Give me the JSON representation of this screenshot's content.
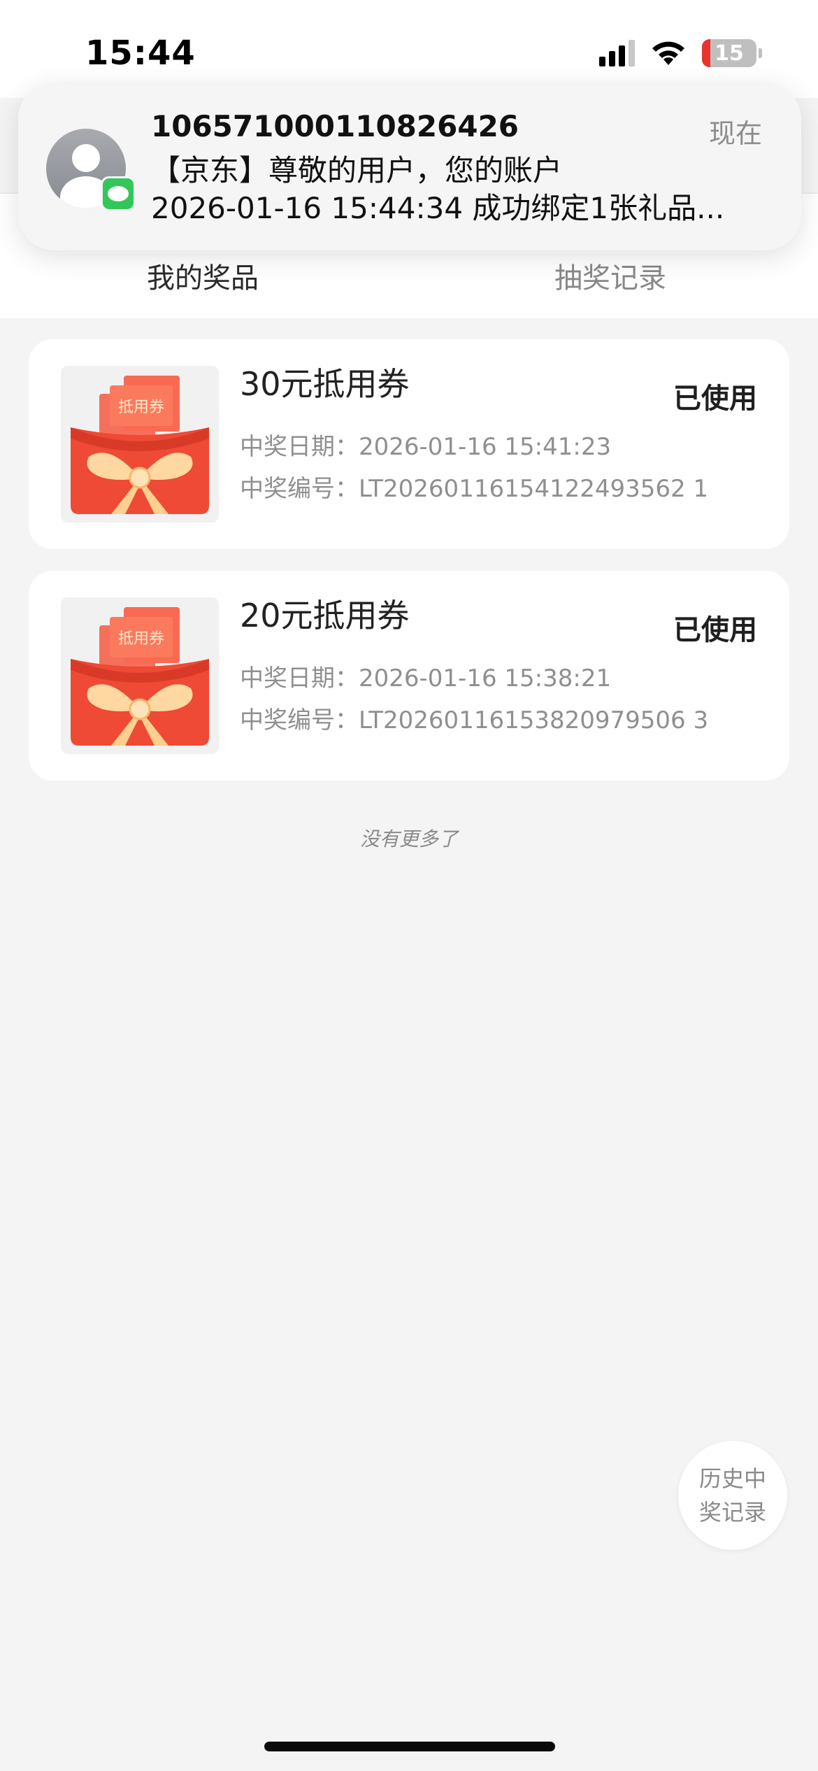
{
  "status_bar": {
    "time": "15:44",
    "battery_level": "15",
    "icons": [
      "cellular-signal-icon",
      "wifi-icon",
      "battery-icon"
    ]
  },
  "notification": {
    "sender": "106571000110826426",
    "time": "现在",
    "line1": "【京东】尊敬的用户，您的账户",
    "line2": "2026-01-16 15:44:34 成功绑定1张礼品...",
    "app_icon": "messages-icon"
  },
  "tabs": [
    {
      "label": "我的奖品",
      "active": true
    },
    {
      "label": "抽奖记录",
      "active": false
    }
  ],
  "prizes": [
    {
      "title": "30元抵用券",
      "status": "已使用",
      "image_label": "抵用券",
      "date_label": "中奖日期：",
      "date": "2026-01-16 15:41:23",
      "code_label": "中奖编号：",
      "code": "LT20260116154122493562 1"
    },
    {
      "title": "20元抵用券",
      "status": "已使用",
      "image_label": "抵用券",
      "date_label": "中奖日期：",
      "date": "2026-01-16 15:38:21",
      "code_label": "中奖编号：",
      "code": "LT20260116153820979506 3"
    }
  ],
  "footer_text": "没有更多了",
  "history_button": {
    "line1": "历史中",
    "line2": "奖记录"
  },
  "colors": {
    "red_envelope": "#f0503a",
    "ribbon": "#ffd9a0",
    "badge_green": "#33c759"
  }
}
